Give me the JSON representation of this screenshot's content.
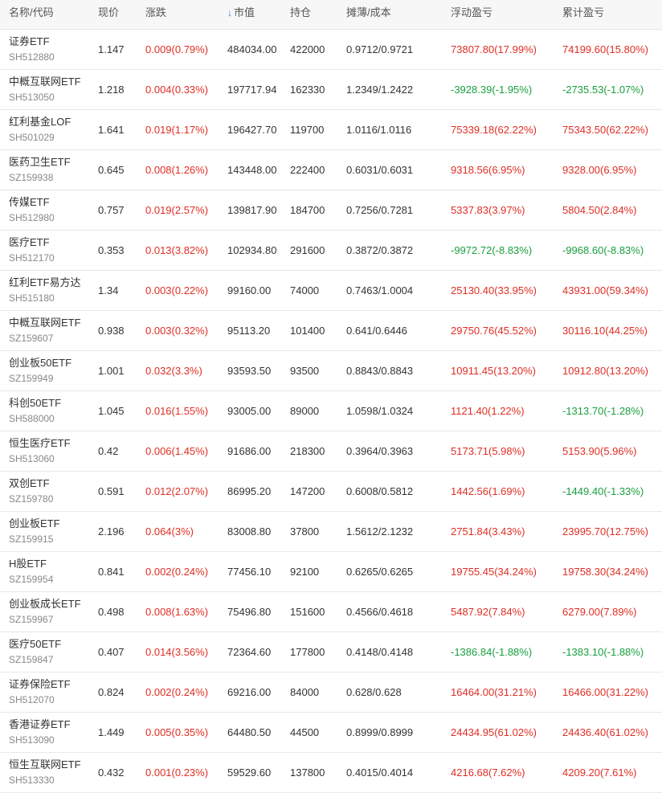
{
  "header": {
    "name_code": "名称/代码",
    "price": "现价",
    "change": "涨跌",
    "market_value": "市值",
    "holding": "持仓",
    "cost": "摊薄/成本",
    "float_pl": "浮动盈亏",
    "total_pl": "累计盈亏",
    "sort_icon": "↓",
    "sort_icon_name": "arrow-down-icon"
  },
  "colors": {
    "up": "#e02e24",
    "down": "#1a9e3f",
    "sort_accent": "#2f7be0"
  },
  "rows": [
    {
      "name": "证券ETF",
      "code": "SH512880",
      "price": "1.147",
      "change": "0.009(0.79%)",
      "change_dir": "up",
      "mv": "484034.00",
      "hold": "422000",
      "cost": "0.9712/0.9721",
      "float": "73807.80(17.99%)",
      "float_dir": "up",
      "total": "74199.60(15.80%)",
      "total_dir": "up"
    },
    {
      "name": "中概互联网ETF",
      "code": "SH513050",
      "price": "1.218",
      "change": "0.004(0.33%)",
      "change_dir": "up",
      "mv": "197717.94",
      "hold": "162330",
      "cost": "1.2349/1.2422",
      "float": "-3928.39(-1.95%)",
      "float_dir": "down",
      "total": "-2735.53(-1.07%)",
      "total_dir": "down"
    },
    {
      "name": "红利基金LOF",
      "code": "SH501029",
      "price": "1.641",
      "change": "0.019(1.17%)",
      "change_dir": "up",
      "mv": "196427.70",
      "hold": "119700",
      "cost": "1.0116/1.0116",
      "float": "75339.18(62.22%)",
      "float_dir": "up",
      "total": "75343.50(62.22%)",
      "total_dir": "up"
    },
    {
      "name": "医药卫生ETF",
      "code": "SZ159938",
      "price": "0.645",
      "change": "0.008(1.26%)",
      "change_dir": "up",
      "mv": "143448.00",
      "hold": "222400",
      "cost": "0.6031/0.6031",
      "float": "9318.56(6.95%)",
      "float_dir": "up",
      "total": "9328.00(6.95%)",
      "total_dir": "up"
    },
    {
      "name": "传媒ETF",
      "code": "SH512980",
      "price": "0.757",
      "change": "0.019(2.57%)",
      "change_dir": "up",
      "mv": "139817.90",
      "hold": "184700",
      "cost": "0.7256/0.7281",
      "float": "5337.83(3.97%)",
      "float_dir": "up",
      "total": "5804.50(2.84%)",
      "total_dir": "up"
    },
    {
      "name": "医疗ETF",
      "code": "SH512170",
      "price": "0.353",
      "change": "0.013(3.82%)",
      "change_dir": "up",
      "mv": "102934.80",
      "hold": "291600",
      "cost": "0.3872/0.3872",
      "float": "-9972.72(-8.83%)",
      "float_dir": "down",
      "total": "-9968.60(-8.83%)",
      "total_dir": "down"
    },
    {
      "name": "红利ETF易方达",
      "code": "SH515180",
      "price": "1.34",
      "change": "0.003(0.22%)",
      "change_dir": "up",
      "mv": "99160.00",
      "hold": "74000",
      "cost": "0.7463/1.0004",
      "float": "25130.40(33.95%)",
      "float_dir": "up",
      "total": "43931.00(59.34%)",
      "total_dir": "up"
    },
    {
      "name": "中概互联网ETF",
      "code": "SZ159607",
      "price": "0.938",
      "change": "0.003(0.32%)",
      "change_dir": "up",
      "mv": "95113.20",
      "hold": "101400",
      "cost": "0.641/0.6446",
      "float": "29750.76(45.52%)",
      "float_dir": "up",
      "total": "30116.10(44.25%)",
      "total_dir": "up"
    },
    {
      "name": "创业板50ETF",
      "code": "SZ159949",
      "price": "1.001",
      "change": "0.032(3.3%)",
      "change_dir": "up",
      "mv": "93593.50",
      "hold": "93500",
      "cost": "0.8843/0.8843",
      "float": "10911.45(13.20%)",
      "float_dir": "up",
      "total": "10912.80(13.20%)",
      "total_dir": "up"
    },
    {
      "name": "科创50ETF",
      "code": "SH588000",
      "price": "1.045",
      "change": "0.016(1.55%)",
      "change_dir": "up",
      "mv": "93005.00",
      "hold": "89000",
      "cost": "1.0598/1.0324",
      "float": "1121.40(1.22%)",
      "float_dir": "up",
      "total": "-1313.70(-1.28%)",
      "total_dir": "down"
    },
    {
      "name": "恒生医疗ETF",
      "code": "SH513060",
      "price": "0.42",
      "change": "0.006(1.45%)",
      "change_dir": "up",
      "mv": "91686.00",
      "hold": "218300",
      "cost": "0.3964/0.3963",
      "float": "5173.71(5.98%)",
      "float_dir": "up",
      "total": "5153.90(5.96%)",
      "total_dir": "up"
    },
    {
      "name": "双创ETF",
      "code": "SZ159780",
      "price": "0.591",
      "change": "0.012(2.07%)",
      "change_dir": "up",
      "mv": "86995.20",
      "hold": "147200",
      "cost": "0.6008/0.5812",
      "float": "1442.56(1.69%)",
      "float_dir": "up",
      "total": "-1449.40(-1.33%)",
      "total_dir": "down"
    },
    {
      "name": "创业板ETF",
      "code": "SZ159915",
      "price": "2.196",
      "change": "0.064(3%)",
      "change_dir": "up",
      "mv": "83008.80",
      "hold": "37800",
      "cost": "1.5612/2.1232",
      "float": "2751.84(3.43%)",
      "float_dir": "up",
      "total": "23995.70(12.75%)",
      "total_dir": "up"
    },
    {
      "name": "H股ETF",
      "code": "SZ159954",
      "price": "0.841",
      "change": "0.002(0.24%)",
      "change_dir": "up",
      "mv": "77456.10",
      "hold": "92100",
      "cost": "0.6265/0.6265",
      "float": "19755.45(34.24%)",
      "float_dir": "up",
      "total": "19758.30(34.24%)",
      "total_dir": "up"
    },
    {
      "name": "创业板成长ETF",
      "code": "SZ159967",
      "price": "0.498",
      "change": "0.008(1.63%)",
      "change_dir": "up",
      "mv": "75496.80",
      "hold": "151600",
      "cost": "0.4566/0.4618",
      "float": "5487.92(7.84%)",
      "float_dir": "up",
      "total": "6279.00(7.89%)",
      "total_dir": "up"
    },
    {
      "name": "医疗50ETF",
      "code": "SZ159847",
      "price": "0.407",
      "change": "0.014(3.56%)",
      "change_dir": "up",
      "mv": "72364.60",
      "hold": "177800",
      "cost": "0.4148/0.4148",
      "float": "-1386.84(-1.88%)",
      "float_dir": "down",
      "total": "-1383.10(-1.88%)",
      "total_dir": "down"
    },
    {
      "name": "证券保险ETF",
      "code": "SH512070",
      "price": "0.824",
      "change": "0.002(0.24%)",
      "change_dir": "up",
      "mv": "69216.00",
      "hold": "84000",
      "cost": "0.628/0.628",
      "float": "16464.00(31.21%)",
      "float_dir": "up",
      "total": "16466.00(31.22%)",
      "total_dir": "up"
    },
    {
      "name": "香港证券ETF",
      "code": "SH513090",
      "price": "1.449",
      "change": "0.005(0.35%)",
      "change_dir": "up",
      "mv": "64480.50",
      "hold": "44500",
      "cost": "0.8999/0.8999",
      "float": "24434.95(61.02%)",
      "float_dir": "up",
      "total": "24436.40(61.02%)",
      "total_dir": "up"
    },
    {
      "name": "恒生互联网ETF",
      "code": "SH513330",
      "price": "0.432",
      "change": "0.001(0.23%)",
      "change_dir": "up",
      "mv": "59529.60",
      "hold": "137800",
      "cost": "0.4015/0.4014",
      "float": "4216.68(7.62%)",
      "float_dir": "up",
      "total": "4209.20(7.61%)",
      "total_dir": "up"
    }
  ]
}
